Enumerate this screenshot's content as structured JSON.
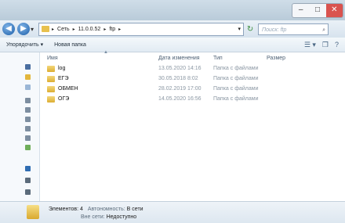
{
  "window": {
    "min_label": "–",
    "max_label": "□",
    "close_label": "✕"
  },
  "address": {
    "back": "◀",
    "forward": "▶",
    "recent": "▾",
    "crumbs": [
      "Сеть",
      "11.0.0.52",
      "ftp"
    ],
    "crumb_sep": "▸",
    "dropdown": "▾",
    "refresh": "↻",
    "search_placeholder": "Поиск: ftp",
    "search_icon": "⌕"
  },
  "toolbar": {
    "organize": "Упорядочить ▾",
    "new_folder": "Новая папка",
    "views_icon": "☰ ▾",
    "preview_icon": "❐",
    "help_icon": "?"
  },
  "columns": {
    "name": "Имя",
    "date": "Дата изменения",
    "type": "Тип",
    "size": "Размер",
    "sort_arrow": "▲"
  },
  "files": [
    {
      "name": "log",
      "date": "13.05.2020 14:16",
      "type": "Папка с файлами"
    },
    {
      "name": "ЕГЭ",
      "date": "30.05.2018 8:02",
      "type": "Папка с файлами"
    },
    {
      "name": "ОБМЕН",
      "date": "28.02.2019 17:00",
      "type": "Папка с файлами"
    },
    {
      "name": "ОГЭ",
      "date": "14.05.2020 16:56",
      "type": "Папка с файлами"
    }
  ],
  "status": {
    "items_label": "Элементов: 4",
    "offline_label": "Автономность:",
    "offline_value": "В сети",
    "availability_label": "Вне сети:",
    "availability_value": "Недоступно"
  },
  "colors": {
    "folder": "#e2b63c",
    "accent": "#1d5fa8"
  }
}
